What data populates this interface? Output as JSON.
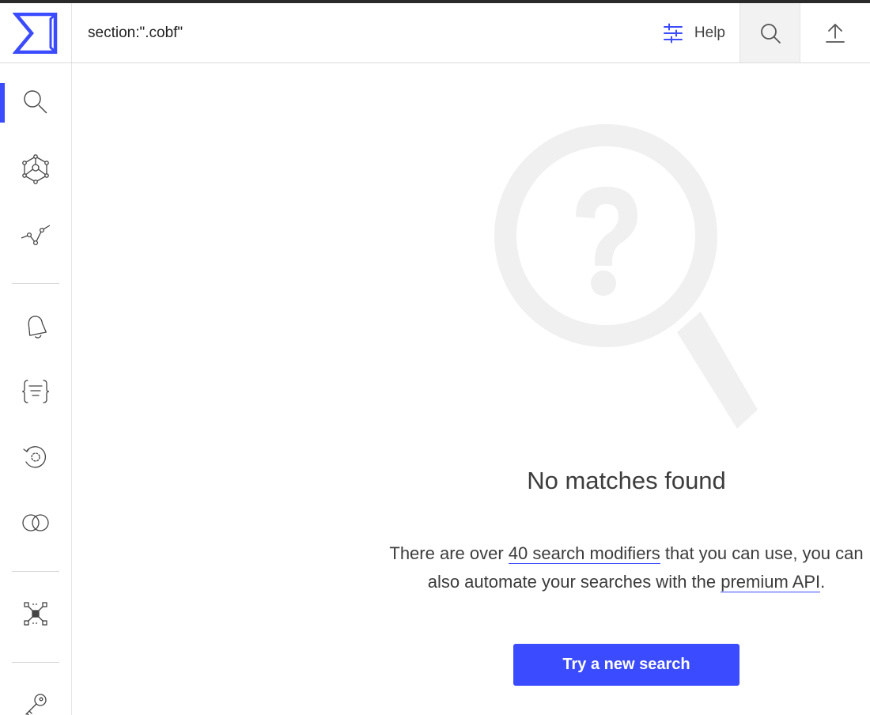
{
  "header": {
    "search_value": "section:\".cobf\"",
    "help_label": "Help",
    "icons": {
      "logo": "sigma-logo-icon",
      "filters": "sliders-icon",
      "search": "search-icon",
      "upload": "upload-icon"
    }
  },
  "sidebar": {
    "items": [
      {
        "name": "search",
        "icon": "search-icon",
        "active": true
      },
      {
        "name": "intelligence-graph",
        "icon": "graph-network-icon",
        "active": false
      },
      {
        "name": "trends",
        "icon": "trend-line-icon",
        "active": false
      },
      {
        "name": "notifications",
        "icon": "bell-icon",
        "active": false
      },
      {
        "name": "rules",
        "icon": "rules-brackets-icon",
        "active": false
      },
      {
        "name": "retrohunt",
        "icon": "retrohunt-icon",
        "active": false
      },
      {
        "name": "diff",
        "icon": "overlap-circles-icon",
        "active": false
      },
      {
        "name": "collections",
        "icon": "cluster-icon",
        "active": false
      },
      {
        "name": "api-key",
        "icon": "key-icon",
        "active": false
      }
    ]
  },
  "empty_state": {
    "illustration": "magnifier-question-icon",
    "title": "No matches found",
    "desc_part1": "There are over ",
    "desc_link1": "40 search modifiers",
    "desc_part2": " that you can use, you can also automate your searches with the ",
    "desc_link2": "premium API",
    "desc_part3": ".",
    "button_label": "Try a new search"
  },
  "colors": {
    "accent": "#3b4bff",
    "text": "#3c3c3c",
    "illustration": "#f0f0f0"
  }
}
